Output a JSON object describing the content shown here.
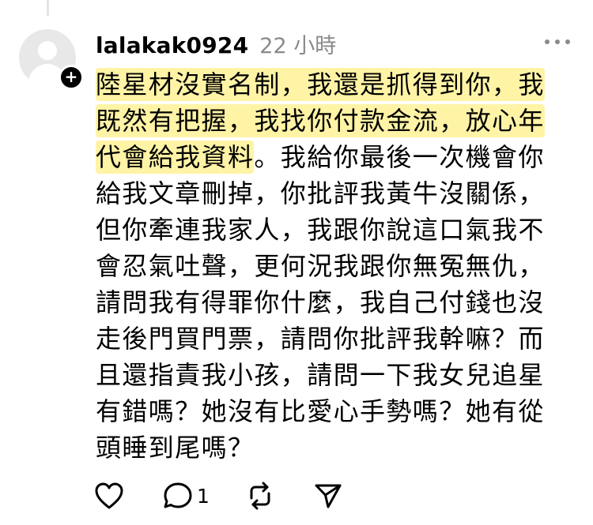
{
  "post": {
    "username": "lalakak0924",
    "timestamp": "22 小時",
    "text_highlighted": "陸星材沒實名制，我還是抓得到你，我既然有把握，我找你付款金流，放心年代會給我資料",
    "text_rest": "。我給你最後一次機會你給我文章刪掉，你批評我黃牛沒關係，但你牽連我家人，我跟你說這口氣我不會忍氣吐聲，更何況我跟你無冤無仇，請問我有得罪你什麼，我自己付錢也沒走後門買門票，請問你批評我幹嘛？而且還指責我小孩，請問一下我女兒追星有錯嗎？她沒有比愛心手勢嗎？她有從頭睡到尾嗎？",
    "avatar_badge": "+",
    "actions": {
      "like_icon": "heart-icon",
      "reply_icon": "comment-icon",
      "reply_count": "1",
      "repost_icon": "repost-icon",
      "share_icon": "send-icon"
    }
  },
  "colors": {
    "highlight": "#fff3a6",
    "secondary_text": "#8a8a8a",
    "avatar_bg": "#e8e8e8"
  }
}
